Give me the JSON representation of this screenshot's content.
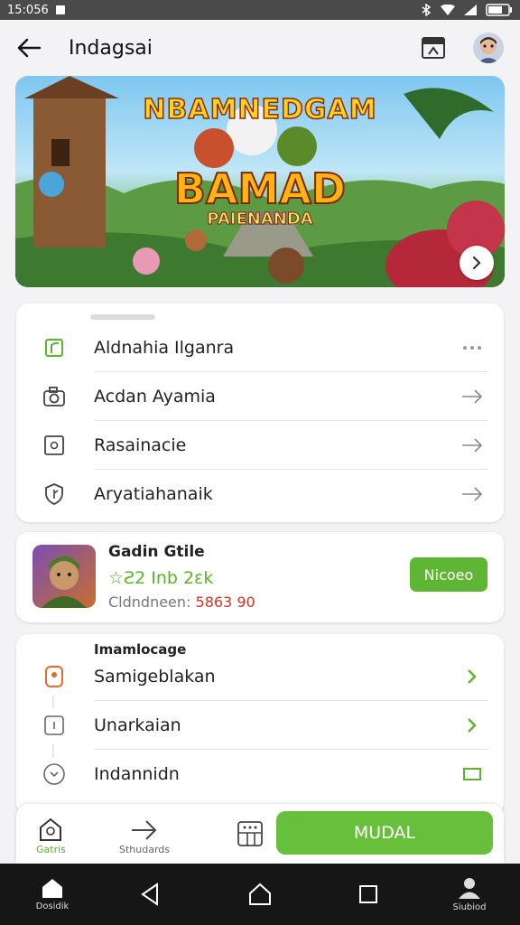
{
  "status_bar": {
    "time": "15:056"
  },
  "app_bar": {
    "title": "Indagsai"
  },
  "banner": {
    "title_top": "NBAMNEDGAM",
    "title_main": "BAMAD",
    "subtitle": "PAIENANDA"
  },
  "menu": {
    "items": [
      {
        "label": "Aldnahia Ilganra",
        "icon": "leaf-icon",
        "trailing": "more-dots-icon"
      },
      {
        "label": "Acdan Ayamia",
        "icon": "camera-icon",
        "trailing": "arrow-right-icon"
      },
      {
        "label": "Rasainacie",
        "icon": "info-box-icon",
        "trailing": "arrow-right-icon"
      },
      {
        "label": "Aryatiahanaik",
        "icon": "shield-icon",
        "trailing": "arrow-right-icon"
      }
    ]
  },
  "game": {
    "name": "Gadin Gtile",
    "rating": "☆Ƨ2 Inb 2ɛk",
    "meta_prefix": "Cldndneen: ",
    "meta_value": "5863 90",
    "button": "Nicoeo"
  },
  "settings": {
    "title": "Imamlocage",
    "items": [
      {
        "label": "Samigeblakan",
        "icon": "location-pin-icon",
        "trailing": "chevron-right-icon"
      },
      {
        "label": "Unarkaian",
        "icon": "square-icon",
        "trailing": "chevron-right-icon"
      },
      {
        "label": "Indannidn",
        "icon": "clock-icon",
        "trailing": "rectangle-icon"
      }
    ]
  },
  "bottom_actions": {
    "tab1": "Gatris",
    "tab2": "Sthudards",
    "button": "MUDAL"
  },
  "nav_bar": {
    "home_label": "Dosidik",
    "profile_label": "Siubiod"
  },
  "colors": {
    "accent_green": "#5fb635",
    "status_bar": "#4a4a4a",
    "nav_bar": "#161616",
    "orange_icon": "#e66a2c"
  }
}
